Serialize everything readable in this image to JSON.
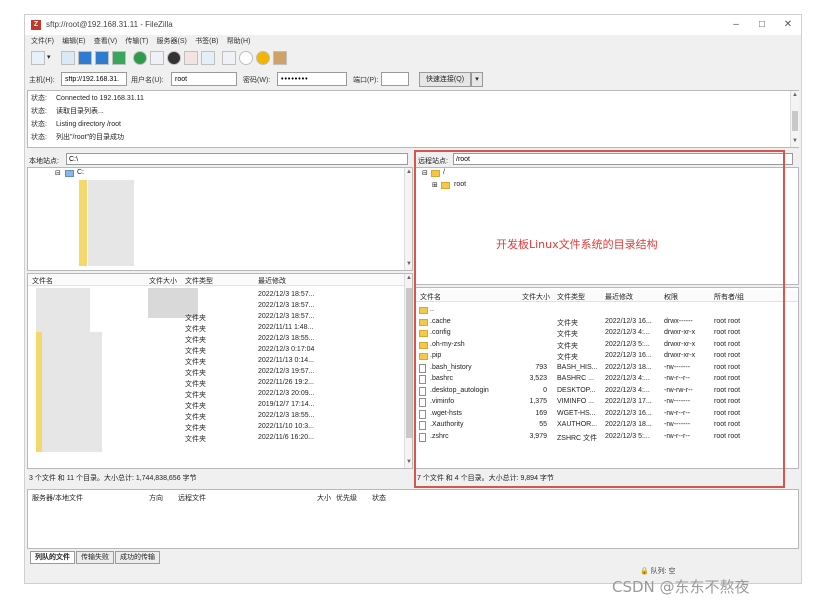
{
  "window": {
    "title": "sftp://root@192.168.31.11 - FileZilla",
    "minimize": "–",
    "maximize": "□",
    "close": "✕"
  },
  "menu": [
    "文件(F)",
    "编辑(E)",
    "查看(V)",
    "传输(T)",
    "服务器(S)",
    "书签(B)",
    "帮助(H)"
  ],
  "quickconnect": {
    "host_label": "主机(H):",
    "host_value": "sftp://192.168.31.",
    "user_label": "用户名(U):",
    "user_value": "root",
    "pass_label": "密码(W):",
    "pass_value": "••••••••",
    "port_label": "端口(P):",
    "port_value": "",
    "button": "快速连接(Q)",
    "dropdown": "▾"
  },
  "log": [
    {
      "tag": "状态:",
      "text": "Connected to 192.168.31.11"
    },
    {
      "tag": "状态:",
      "text": "读取目录列表..."
    },
    {
      "tag": "状态:",
      "text": "Listing directory /root"
    },
    {
      "tag": "状态:",
      "text": "列出\"/root\"的目录成功"
    }
  ],
  "local": {
    "site_label": "本地站点:",
    "site_value": "C:\\",
    "tree_drive": "C:",
    "columns": [
      "文件名",
      "文件大小",
      "文件类型",
      "最近修改"
    ],
    "rows": [
      {
        "type": "",
        "modified": "2022/12/3 18:57..."
      },
      {
        "type": "",
        "modified": "2022/12/3 18:57..."
      },
      {
        "type": "文件夹",
        "modified": "2022/12/3 18:57..."
      },
      {
        "type": "文件夹",
        "modified": "2022/11/11 1:48..."
      },
      {
        "type": "文件夹",
        "modified": "2022/12/3 18:55..."
      },
      {
        "type": "文件夹",
        "modified": "2022/12/3 0:17:04"
      },
      {
        "type": "文件夹",
        "modified": "2022/11/13 0:14..."
      },
      {
        "type": "文件夹",
        "modified": "2022/12/3 19:57..."
      },
      {
        "type": "文件夹",
        "modified": "2022/11/26 19:2..."
      },
      {
        "type": "文件夹",
        "modified": "2022/12/3 20:09..."
      },
      {
        "type": "文件夹",
        "modified": "2019/12/7 17:14..."
      },
      {
        "type": "文件夹",
        "modified": "2022/12/3 18:55..."
      },
      {
        "type": "文件夹",
        "modified": "2022/11/10 10:3..."
      },
      {
        "type": "文件夹",
        "modified": "2022/11/6 16:20..."
      }
    ],
    "status": "3 个文件 和 11 个目录。大小总计: 1,744,838,656 字节"
  },
  "remote": {
    "site_label": "远程站点:",
    "site_value": "/root",
    "tree_root": "/",
    "tree_child": "root",
    "annotation": "开发板Linux文件系统的目录结构",
    "columns": [
      "文件名",
      "文件大小",
      "文件类型",
      "最近修改",
      "权限",
      "所有者/组"
    ],
    "rows": [
      {
        "name": "..",
        "size": "",
        "type": "",
        "modified": "",
        "perm": "",
        "owner": "",
        "kind": "folder"
      },
      {
        "name": ".cache",
        "size": "",
        "type": "文件夹",
        "modified": "2022/12/3 16...",
        "perm": "drwx------",
        "owner": "root root",
        "kind": "folder"
      },
      {
        "name": ".config",
        "size": "",
        "type": "文件夹",
        "modified": "2022/12/3 4:...",
        "perm": "drwxr-xr-x",
        "owner": "root root",
        "kind": "folder"
      },
      {
        "name": ".oh-my-zsh",
        "size": "",
        "type": "文件夹",
        "modified": "2022/12/3 5:...",
        "perm": "drwxr-xr-x",
        "owner": "root root",
        "kind": "folder"
      },
      {
        "name": ".pip",
        "size": "",
        "type": "文件夹",
        "modified": "2022/12/3 16...",
        "perm": "drwxr-xr-x",
        "owner": "root root",
        "kind": "folder"
      },
      {
        "name": ".bash_history",
        "size": "793",
        "type": "BASH_HIS...",
        "modified": "2022/12/3 18...",
        "perm": "-rw-------",
        "owner": "root root",
        "kind": "file"
      },
      {
        "name": ".bashrc",
        "size": "3,523",
        "type": "BASHRC ...",
        "modified": "2022/12/3 4:...",
        "perm": "-rw-r--r--",
        "owner": "root root",
        "kind": "file"
      },
      {
        "name": ".desktop_autologin",
        "size": "0",
        "type": "DESKTOP...",
        "modified": "2022/12/3 4:...",
        "perm": "-rw-rw-r--",
        "owner": "root root",
        "kind": "file"
      },
      {
        "name": ".viminfo",
        "size": "1,375",
        "type": "VIMINFO ...",
        "modified": "2022/12/3 17...",
        "perm": "-rw-------",
        "owner": "root root",
        "kind": "file"
      },
      {
        "name": ".wget-hsts",
        "size": "169",
        "type": "WGET-HS...",
        "modified": "2022/12/3 16...",
        "perm": "-rw-r--r--",
        "owner": "root root",
        "kind": "file"
      },
      {
        "name": ".Xauthority",
        "size": "55",
        "type": "XAUTHOR...",
        "modified": "2022/12/3 18...",
        "perm": "-rw-------",
        "owner": "root root",
        "kind": "file"
      },
      {
        "name": ".zshrc",
        "size": "3,979",
        "type": "ZSHRC 文件",
        "modified": "2022/12/3 5:...",
        "perm": "-rw-r--r--",
        "owner": "root root",
        "kind": "file"
      }
    ],
    "status": "7 个文件 和 4 个目录。大小总计: 9,894 字节"
  },
  "queue": {
    "columns": [
      "服务器/本地文件",
      "方向",
      "远程文件",
      "大小",
      "优先级",
      "状态"
    ]
  },
  "tabs": [
    "列队的文件",
    "传输失败",
    "成功的传输"
  ],
  "bottom": {
    "queue_label": "队列: 空"
  },
  "watermark": "CSDN @东东不熬夜",
  "colors": {
    "annotation": "#e53935",
    "folder": "#f2c94c",
    "accent": "#d9534f"
  }
}
